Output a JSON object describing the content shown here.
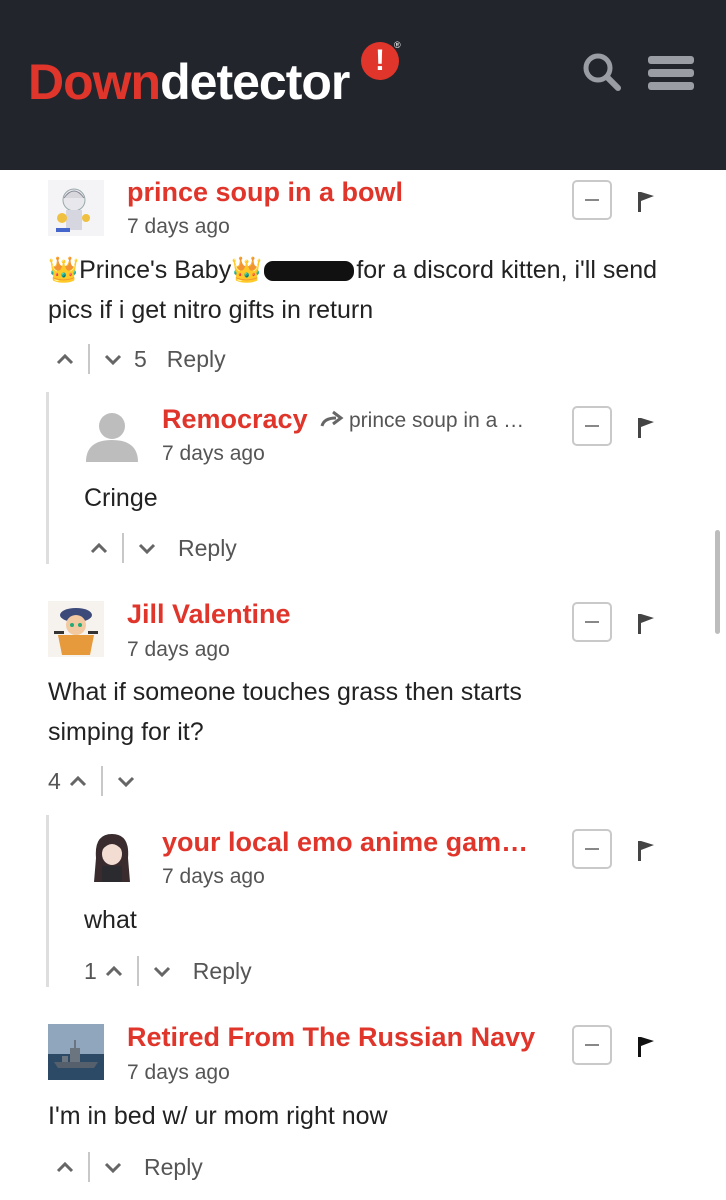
{
  "header": {
    "logo_down": "Down",
    "logo_detector": "detector",
    "logo_bang": "!",
    "logo_reg": "®"
  },
  "comments": [
    {
      "author": "prince soup in a bowl",
      "time": "7 days ago",
      "body_pre": "👑Prince's Baby👑",
      "body_post": "for a discord kitten, i'll send pics if i get nitro gifts in return",
      "vote_count": "5",
      "reply_label": "Reply"
    },
    {
      "author": "Remocracy",
      "reply_to": "prince soup in a …",
      "time": "7 days ago",
      "body": "Cringe",
      "reply_label": "Reply"
    },
    {
      "author": "Jill Valentine",
      "time": "7 days ago",
      "body": "What if someone touches grass then starts simping for it?",
      "vote_count": "4"
    },
    {
      "author": "your local emo anime gam…",
      "time": "7 days ago",
      "body": "what",
      "vote_count": "1",
      "reply_label": "Reply"
    },
    {
      "author": "Retired From The Russian Navy",
      "time": "7 days ago",
      "body": "I'm in bed w/ ur mom right now",
      "reply_label": "Reply"
    }
  ],
  "colors": {
    "header_bg": "#23252d",
    "brand_red": "#e0352b",
    "author_red": "#e0352b",
    "meta_gray": "#555555"
  },
  "icons": [
    "search-icon",
    "menu-icon",
    "minus-icon",
    "flag-icon",
    "chevron-up-icon",
    "chevron-down-icon",
    "arrow-right-icon"
  ]
}
